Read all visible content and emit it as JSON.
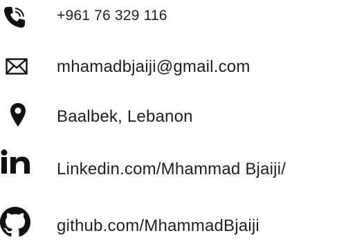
{
  "contacts": {
    "phone": {
      "icon": "phone-icon",
      "text": "+961 76 329 116"
    },
    "email": {
      "icon": "envelope-icon",
      "text": "mhamadbjaiji@gmail.com"
    },
    "location": {
      "icon": "map-pin-icon",
      "text": "Baalbek, Lebanon"
    },
    "linkedin": {
      "icon": "linkedin-icon",
      "text": "Linkedin.com/Mhammad Bjaiji/"
    },
    "github": {
      "icon": "github-icon",
      "text": "github.com/MhammadBjaiji"
    }
  },
  "colors": {
    "text": "#1f1f1f",
    "icon": "#111111"
  }
}
